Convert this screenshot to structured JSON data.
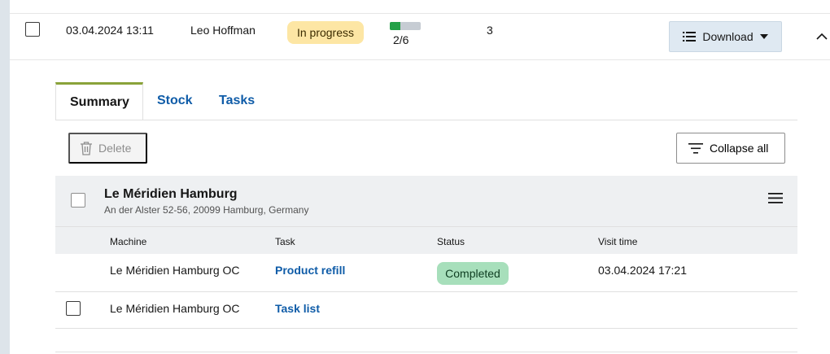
{
  "order": {
    "datetime": "03.04.2024 13:11",
    "assignee": "Leo Hoffman",
    "status": "In progress",
    "progress_label": "2/6",
    "progress_fraction": 0.333,
    "count": "3",
    "download_label": "Download",
    "progress_color": "#24a148",
    "status_color": "#fde6a4"
  },
  "tabs": [
    {
      "label": "Summary",
      "active": true
    },
    {
      "label": "Stock",
      "active": false
    },
    {
      "label": "Tasks",
      "active": false
    }
  ],
  "toolbar": {
    "delete_label": "Delete",
    "collapse_label": "Collapse all"
  },
  "group": {
    "title": "Le Méridien Hamburg",
    "address": "An der Alster 52-56, 20099 Hamburg, Germany"
  },
  "table": {
    "headers": [
      "Machine",
      "Task",
      "Status",
      "Visit time"
    ],
    "rows": [
      {
        "machine": "Le Méridien Hamburg OC",
        "task": "Product refill",
        "status": "Completed",
        "visit_time": "03.04.2024 17:21"
      },
      {
        "machine": "Le Méridien Hamburg OC",
        "task": "Task list",
        "status": "",
        "visit_time": ""
      }
    ]
  },
  "colors": {
    "accent_tab": "#8aa33a",
    "link": "#0f5ca8",
    "completed": "#a7dfbb"
  }
}
